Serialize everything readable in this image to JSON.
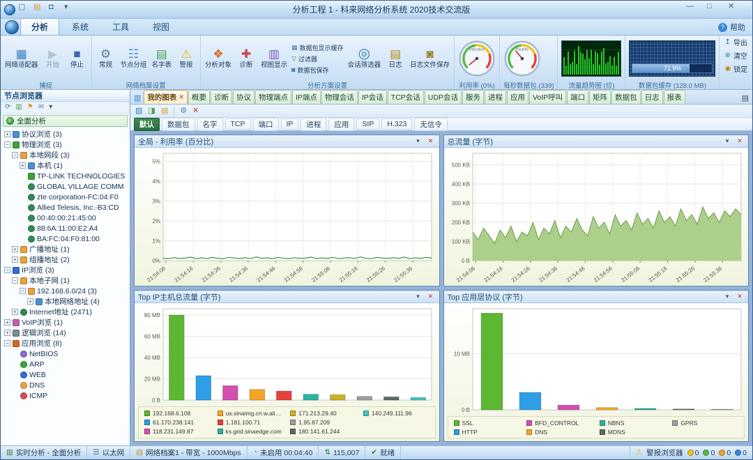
{
  "window": {
    "title": "分析工程 1 - 科来网络分析系统 2020技术交流版"
  },
  "ribbon": {
    "tabs": [
      "分析",
      "系统",
      "工具",
      "视图"
    ],
    "active_tab": "分析",
    "help_label": "帮助",
    "groups": {
      "capture": {
        "label": "捕捉",
        "adapter": "网络适配器",
        "start": "开始",
        "stop": "停止"
      },
      "profile": {
        "label": "网络档案设置",
        "items": [
          "常规",
          "节点分组",
          "名字表",
          "警报"
        ]
      },
      "analysis": {
        "label": "分析方案设置",
        "big1": [
          "分析对象",
          "诊断",
          "视图显示"
        ],
        "small": [
          "数据包显示缓存",
          "过滤器",
          "数据包保存"
        ],
        "big2": [
          "会话筛选器",
          "日志",
          "日志文件保存"
        ]
      },
      "utilization": {
        "label": "利用率 (0%)",
        "face": "Utilization",
        "fraction": 0.02
      },
      "pps": {
        "label": "每秒数据包 (339)",
        "face": "Packets",
        "fraction": 0.35
      },
      "trend": {
        "label": "流量趋势图 (位)"
      },
      "buffer": {
        "label": "数据包缓存 (128.0 MB)",
        "percent": "71.9%",
        "fraction": 0.719
      },
      "actions": [
        "导出",
        "清空",
        "锁定"
      ]
    }
  },
  "sidebar": {
    "title": "节点浏览器",
    "root": "全面分析",
    "tree": [
      {
        "label": "协议浏览",
        "count": "(3)",
        "level": 0,
        "expand": "+",
        "color": "#4a90d9",
        "shape": "square"
      },
      {
        "label": "物理浏览",
        "count": "(3)",
        "level": 0,
        "expand": "-",
        "color": "#3aa53a",
        "shape": "square"
      },
      {
        "label": "本地网段",
        "count": "(3)",
        "level": 1,
        "expand": "-",
        "color": "#e8a33d",
        "shape": "square"
      },
      {
        "label": "本机",
        "count": "(1)",
        "level": 2,
        "expand": "+",
        "color": "#4a90d9",
        "shape": "square"
      },
      {
        "label": "TP-LINK TECHNOLOGIES",
        "count": "",
        "level": 2,
        "expand": "",
        "color": "#3aa53a",
        "shape": "square"
      },
      {
        "label": "GLOBAL VILLAGE COMM",
        "count": "",
        "level": 2,
        "expand": "",
        "color": "#2e8b57",
        "shape": "circle"
      },
      {
        "label": "zte corporation-FC:04:F0",
        "count": "",
        "level": 2,
        "expand": "",
        "color": "#2e8b57",
        "shape": "circle"
      },
      {
        "label": "Allied Telesis, Inc.-B3:CD",
        "count": "",
        "level": 2,
        "expand": "",
        "color": "#2e8b57",
        "shape": "circle"
      },
      {
        "label": "00:40:00:21:45:00",
        "count": "",
        "level": 2,
        "expand": "",
        "color": "#2e8b57",
        "shape": "circle"
      },
      {
        "label": "88:6A:11:00:E2:A4",
        "count": "",
        "level": 2,
        "expand": "",
        "color": "#2e8b57",
        "shape": "circle"
      },
      {
        "label": "BA:FC:04:F0:81:00",
        "count": "",
        "level": 2,
        "expand": "",
        "color": "#2e8b57",
        "shape": "circle"
      },
      {
        "label": "广播地址",
        "count": "(1)",
        "level": 1,
        "expand": "+",
        "color": "#e8a33d",
        "shape": "square"
      },
      {
        "label": "组播地址",
        "count": "(2)",
        "level": 1,
        "expand": "+",
        "color": "#e8a33d",
        "shape": "square"
      },
      {
        "label": "IP浏览",
        "count": "(3)",
        "level": 0,
        "expand": "-",
        "color": "#2e6ed9",
        "shape": "square"
      },
      {
        "label": "本地子网",
        "count": "(1)",
        "level": 1,
        "expand": "-",
        "color": "#e8a33d",
        "shape": "square"
      },
      {
        "label": "192.168.6.0/24",
        "count": "(3)",
        "level": 2,
        "expand": "-",
        "color": "#e8a33d",
        "shape": "square"
      },
      {
        "label": "本地网络地址",
        "count": "(4)",
        "level": 3,
        "expand": "+",
        "color": "#4a90d9",
        "shape": "square"
      },
      {
        "label": "Internet地址",
        "count": "(2471)",
        "level": 1,
        "expand": "+",
        "color": "#2e8b57",
        "shape": "circle"
      },
      {
        "label": "VoIP浏览",
        "count": "(1)",
        "level": 0,
        "expand": "+",
        "color": "#c75db0",
        "shape": "square"
      },
      {
        "label": "逻辑浏览",
        "count": "(14)",
        "level": 0,
        "expand": "+",
        "color": "#7a8a99",
        "shape": "square"
      },
      {
        "label": "应用浏览",
        "count": "(8)",
        "level": 0,
        "expand": "-",
        "color": "#d2691e",
        "shape": "square"
      },
      {
        "label": "NetBIOS",
        "count": "",
        "level": 1,
        "expand": "",
        "color": "#8a6ad9",
        "shape": "circle"
      },
      {
        "label": "ARP",
        "count": "",
        "level": 1,
        "expand": "",
        "color": "#3aa53a",
        "shape": "circle"
      },
      {
        "label": "WEB",
        "count": "",
        "level": 1,
        "expand": "",
        "color": "#2e6ed9",
        "shape": "circle"
      },
      {
        "label": "DNS",
        "count": "",
        "level": 1,
        "expand": "",
        "color": "#e8a33d",
        "shape": "circle"
      },
      {
        "label": "ICMP",
        "count": "",
        "level": 1,
        "expand": "",
        "color": "#d94a4a",
        "shape": "circle"
      }
    ]
  },
  "main": {
    "view_tabs": [
      "我的图表",
      "概要",
      "诊断",
      "协议",
      "物理端点",
      "IP端点",
      "物理会话",
      "IP会话",
      "TCP会话",
      "UDP会话",
      "服务",
      "进程",
      "应用",
      "VoIP呼叫",
      "端口",
      "矩阵",
      "数据包",
      "日志",
      "报表"
    ],
    "active_view_tab": "我的图表",
    "filters": [
      "默认",
      "数据包",
      "名字",
      "TCP",
      "端口",
      "IP",
      "进程",
      "应用",
      "SIP",
      "H.323",
      "无信令"
    ],
    "active_filter": "默认"
  },
  "statusbar": {
    "items": [
      {
        "icon": "analysis",
        "text": "实时分析 - 全面分析"
      },
      {
        "icon": "ethernet",
        "text": "以太网"
      },
      {
        "icon": "profile",
        "text": "网络档案1 - 带宽 - 1000Mbps"
      },
      {
        "icon": "inactive",
        "text": "未启用  00:04:40"
      },
      {
        "icon": "packets",
        "text": "115,007"
      },
      {
        "icon": "ready",
        "text": "就绪"
      }
    ],
    "alarm": {
      "label": "警报浏览器",
      "dots": [
        {
          "color": "#f0c419",
          "count": "0"
        },
        {
          "color": "#58b947",
          "count": "0"
        },
        {
          "color": "#f0a030",
          "count": "0"
        },
        {
          "color": "#3a87d6",
          "count": "0"
        }
      ]
    }
  },
  "chart_data": [
    {
      "type": "line",
      "title": "全局 - 利用率 (百分比)",
      "line_color": "#1e7a1e",
      "y_max": 5.4,
      "y_ticks": [
        {
          "v": 0,
          "label": "0%"
        },
        {
          "v": 1,
          "label": "1%"
        },
        {
          "v": 2,
          "label": "2%"
        },
        {
          "v": 3,
          "label": "3%"
        },
        {
          "v": 4,
          "label": "4%"
        },
        {
          "v": 5,
          "label": "5%"
        }
      ],
      "x_ticks": [
        "21:54:06",
        "21:54:16",
        "21:54:26",
        "21:54:36",
        "21:54:46",
        "21:54:56",
        "21:55:06",
        "21:55:16",
        "21:55:26",
        "21:55:36"
      ],
      "values": [
        0.12,
        0.1,
        0.15,
        0.11,
        0.13,
        0.18,
        0.1,
        0.14,
        0.11,
        0.16,
        0.12,
        0.1,
        0.17,
        0.13,
        0.11,
        0.15,
        0.1,
        0.19,
        0.12,
        0.14,
        0.1,
        0.16,
        0.12,
        0.1,
        0.15,
        0.11,
        0.13,
        0.18,
        0.11,
        0.14,
        0.12,
        0.17,
        0.1,
        0.13,
        0.15,
        0.11,
        0.19,
        0.12,
        0.1,
        0.16,
        0.13,
        0.11,
        0.15,
        0.12,
        0.18,
        0.1,
        0.14,
        0.12,
        0.16,
        0.13
      ]
    },
    {
      "type": "area",
      "title": "总流量 (字节)",
      "line_color": "#6f9c4a",
      "fill_color": "#a9cc86",
      "y_max": 560,
      "y_ticks": [
        {
          "v": 0,
          "label": "0 B"
        },
        {
          "v": 100,
          "label": "100 KB"
        },
        {
          "v": 200,
          "label": "200 KB"
        },
        {
          "v": 300,
          "label": "300 KB"
        },
        {
          "v": 400,
          "label": "400 KB"
        },
        {
          "v": 500,
          "label": "500 KB"
        }
      ],
      "x_ticks": [
        "21:54:06",
        "21:54:16",
        "21:54:26",
        "21:54:36",
        "21:54:46",
        "21:54:56",
        "21:55:06",
        "21:55:16",
        "21:55:26",
        "21:55:36"
      ],
      "values": [
        150,
        110,
        170,
        130,
        90,
        160,
        120,
        180,
        100,
        150,
        130,
        200,
        110,
        170,
        140,
        210,
        120,
        180,
        150,
        220,
        160,
        130,
        230,
        170,
        200,
        140,
        240,
        180,
        210,
        160,
        250,
        190,
        220,
        170,
        260,
        200,
        230,
        180,
        270,
        210,
        240,
        190,
        280,
        220,
        250,
        200,
        260,
        230,
        270,
        240
      ]
    },
    {
      "type": "bar",
      "title": "Top IP主机总流量 (字节)",
      "y_max": 86,
      "y_ticks": [
        {
          "v": 0,
          "label": "0 B"
        },
        {
          "v": 20,
          "label": "20 MB"
        },
        {
          "v": 40,
          "label": "40 MB"
        },
        {
          "v": 60,
          "label": "60 MB"
        },
        {
          "v": 80,
          "label": "80 MB"
        }
      ],
      "series": [
        {
          "name": "192.168.6.108",
          "value": 80,
          "color": "#5cb832"
        },
        {
          "name": "61.170.238.141",
          "value": 23,
          "color": "#2e9fe6"
        },
        {
          "name": "118.231.149.87",
          "value": 13.5,
          "color": "#d44fb0"
        },
        {
          "name": "us.sinaimg.cn.w.alikunlun.net",
          "value": 10,
          "color": "#f5a623"
        },
        {
          "name": "1.181.100.71",
          "value": 8.5,
          "color": "#e8413c"
        },
        {
          "name": "ks.grid.sinaedge.com",
          "value": 5.5,
          "color": "#2bb5a0"
        },
        {
          "name": "171.213.29.40",
          "value": 5,
          "color": "#c9b226"
        },
        {
          "name": "1.95.87.209",
          "value": 3.5,
          "color": "#9e9e9e"
        },
        {
          "name": "180.141.61.244",
          "value": 3,
          "color": "#5a6b6b"
        },
        {
          "name": "140.249.111.96",
          "value": 2.4,
          "color": "#3fc6c0"
        }
      ]
    },
    {
      "type": "bar",
      "title": "Top 应用层协议 (字节)",
      "y_max": 18,
      "y_ticks": [
        {
          "v": 0,
          "label": "0 B"
        },
        {
          "v": 10,
          "label": "10 MB"
        }
      ],
      "series": [
        {
          "name": "SSL",
          "value": 17.2,
          "color": "#5cb832"
        },
        {
          "name": "HTTP",
          "value": 3.1,
          "color": "#2e9fe6"
        },
        {
          "name": "BFD_CONTROL",
          "value": 0.85,
          "color": "#d44fb0"
        },
        {
          "name": "DNS",
          "value": 0.4,
          "color": "#f5a623"
        },
        {
          "name": "NBNS",
          "value": 0.25,
          "color": "#2bb5a0"
        },
        {
          "name": "MDNS",
          "value": 0.15,
          "color": "#5a6b6b"
        },
        {
          "name": "GPRS",
          "value": 0.1,
          "color": "#9e9e9e"
        }
      ]
    }
  ]
}
